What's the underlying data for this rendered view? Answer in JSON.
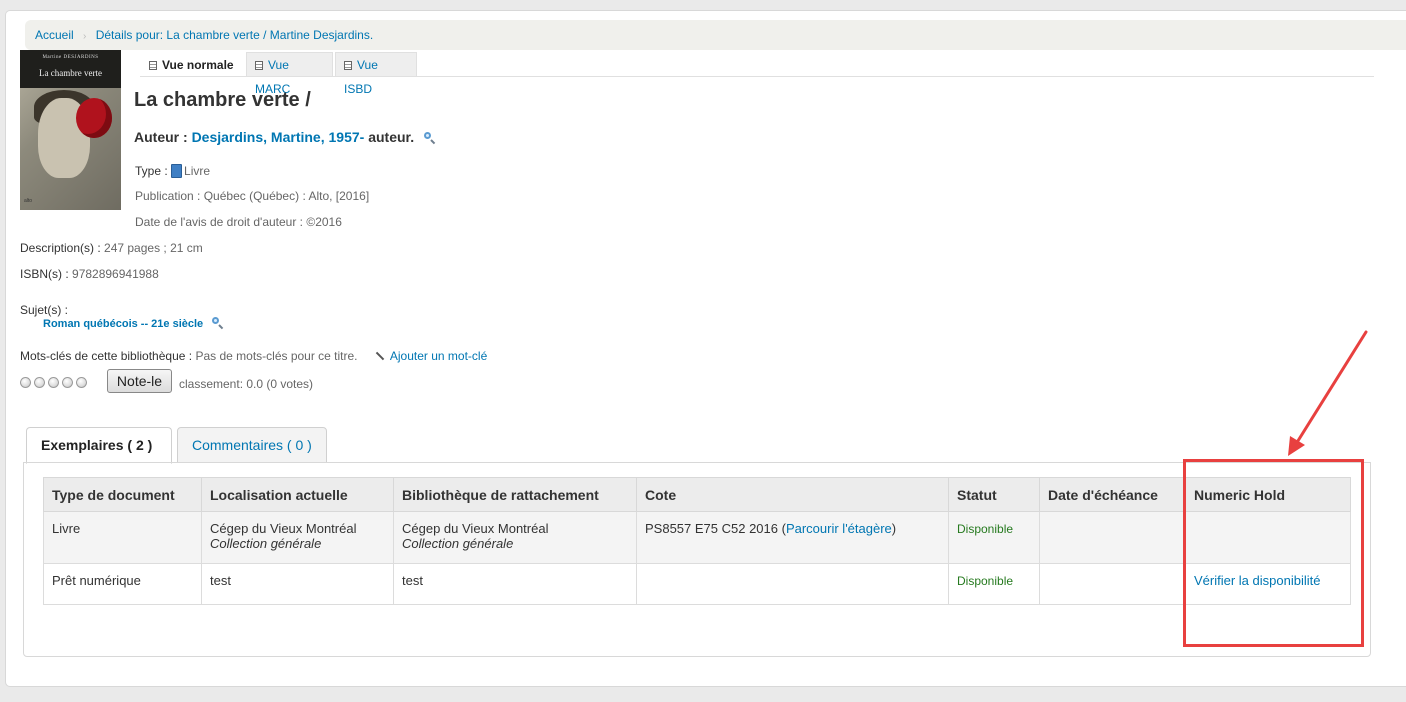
{
  "breadcrumb": {
    "home": "Accueil",
    "current": "Détails pour: La chambre verte / Martine Desjardins."
  },
  "cover": {
    "author": "Martine DESJARDINS",
    "title": "La chambre verte",
    "publisher": "alto"
  },
  "view_tabs": [
    {
      "label": "Vue normale",
      "active": true
    },
    {
      "label": "Vue MARC",
      "active": false
    },
    {
      "label": "Vue ISBD",
      "active": false
    }
  ],
  "record": {
    "title": "La chambre verte /",
    "author_label": "Auteur :",
    "author_name": "Desjardins, Martine, 1957-",
    "author_role": "auteur.",
    "type_label": "Type :",
    "type_value": "Livre",
    "publication_label": "Publication :",
    "publication_value": "Québec (Québec) : Alto, [2016]",
    "copyright_label": "Date de l'avis de droit d'auteur :",
    "copyright_value": "©2016",
    "description_label": "Description(s) :",
    "description_value": "247 pages ; 21 cm",
    "isbn_label": "ISBN(s) :",
    "isbn_value": "9782896941988",
    "subjects_label": "Sujet(s) :",
    "subject": "Roman québécois -- 21e siècle",
    "tags_label": "Mots-clés de cette bibliothèque :",
    "tags_value": "Pas de mots-clés pour ce titre.",
    "add_tag": "Ajouter un mot-clé"
  },
  "rating": {
    "button": "Note-le",
    "summary": "classement: 0.0 (0 votes)",
    "value": 0,
    "max": 5
  },
  "holdings_tabs": [
    {
      "label": "Exemplaires ( 2 )",
      "active": true
    },
    {
      "label": "Commentaires ( 0 )",
      "active": false
    }
  ],
  "holdings": {
    "headers": [
      "Type de document",
      "Localisation actuelle",
      "Bibliothèque de rattachement",
      "Cote",
      "Statut",
      "Date d'échéance",
      "Numeric Hold"
    ],
    "rows": [
      {
        "type": "Livre",
        "location": "Cégep du Vieux Montréal",
        "location_coll": "Collection générale",
        "home": "Cégep du Vieux Montréal",
        "home_coll": "Collection générale",
        "callnumber": "PS8557 E75 C52 2016",
        "browse": "Parcourir l'étagère",
        "status": "Disponible",
        "due": "",
        "hold": ""
      },
      {
        "type": "Prêt numérique",
        "location": "test",
        "location_coll": "",
        "home": "test",
        "home_coll": "",
        "callnumber": "",
        "browse": "",
        "status": "Disponible",
        "due": "",
        "hold": "Vérifier la disponibilité"
      }
    ]
  },
  "annotation_color": "#e8403f",
  "link_color": "#0076b2"
}
